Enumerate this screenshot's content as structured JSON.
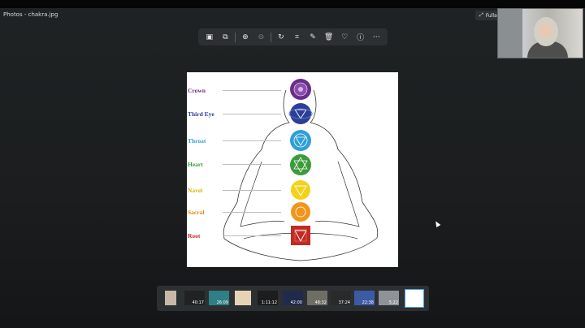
{
  "window": {
    "title": "Photos - chakra.jpg"
  },
  "fullscreen": {
    "label": "Fullscreen"
  },
  "chakras": [
    {
      "label": "Crown",
      "color": "#6a2d8a"
    },
    {
      "label": "Third Eye",
      "color": "#2c3f96"
    },
    {
      "label": "Throat",
      "color": "#2f9fd8"
    },
    {
      "label": "Heart",
      "color": "#3c9b3a"
    },
    {
      "label": "Navel",
      "color": "#f2d21a"
    },
    {
      "label": "Sacral",
      "color": "#f0961c"
    },
    {
      "label": "Root",
      "color": "#c22a22"
    }
  ],
  "thumbnails": [
    {
      "duration": ""
    },
    {
      "duration": "40:17"
    },
    {
      "duration": "26:09"
    },
    {
      "duration": ""
    },
    {
      "duration": "1:11:12"
    },
    {
      "duration": "42:00"
    },
    {
      "duration": "48:32"
    },
    {
      "duration": "37:24"
    },
    {
      "duration": "22:38"
    },
    {
      "duration": "5:22"
    },
    {
      "duration": ""
    }
  ]
}
